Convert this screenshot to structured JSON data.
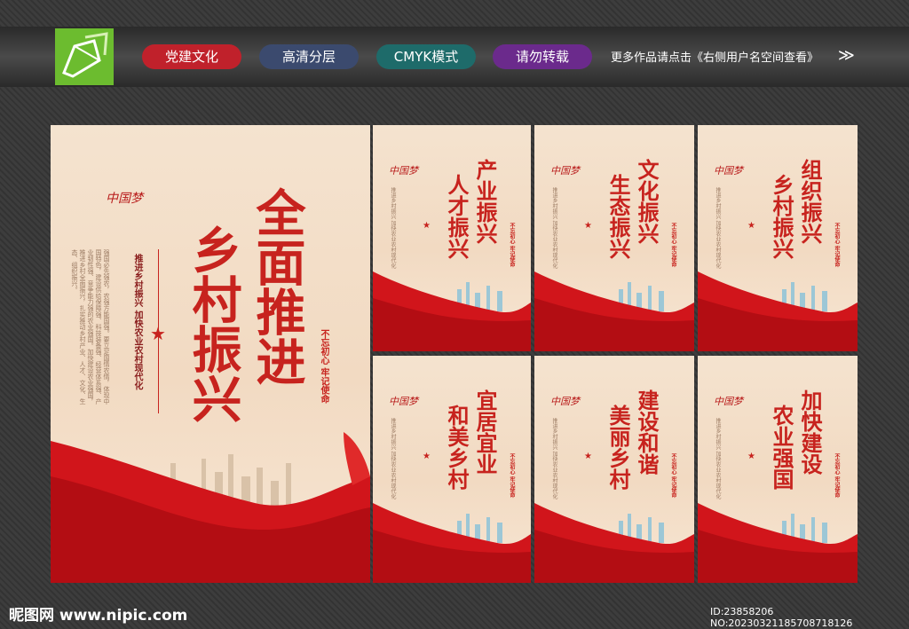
{
  "header": {
    "tags": [
      {
        "label": "党建文化",
        "color": "#c0212b"
      },
      {
        "label": "高清分层",
        "color": "#3b4a6e"
      },
      {
        "label": "CMYK模式",
        "color": "#1e6b6a"
      },
      {
        "label": "请勿转载",
        "color": "#6b2a8c"
      }
    ],
    "notice": "更多作品请点击《右侧用户名空间查看》",
    "arrow": "≫"
  },
  "main_poster": {
    "brand": "中国梦",
    "title_line1": "全面推进",
    "title_line2": "乡村振兴",
    "subtitle": "推进乡村振兴 加快农业农村现代化",
    "body": "强国必先强农，农强方能国强。要立足国情农情，体现中国特色，建设供给保障强、科技装备强、经营体系强、产业韧性强、竞争能力强的农业强国。加快建设农业强国，推进乡村全面振兴，扎实推动乡村产业、人才、文化、生态、组织振兴。",
    "motto": "不忘初心 牢记使命"
  },
  "posters": [
    {
      "line1": "产业振兴",
      "line2": "人才振兴"
    },
    {
      "line1": "文化振兴",
      "line2": "生态振兴"
    },
    {
      "line1": "组织振兴",
      "line2": "乡村振兴"
    },
    {
      "line1": "宜居宜业",
      "line2": "和美乡村"
    },
    {
      "line1": "建设和谐",
      "line2": "美丽乡村"
    },
    {
      "line1": "加快建设",
      "line2": "农业强国"
    }
  ],
  "poster_common": {
    "brand": "中国梦",
    "small_text": "推进乡村振兴 加快农业农村现代化",
    "motto": "不忘初心 牢记使命"
  },
  "footer": {
    "site": "昵图网 www.nipic.com",
    "id": "ID:23858206 NO:20230321185708718126"
  }
}
